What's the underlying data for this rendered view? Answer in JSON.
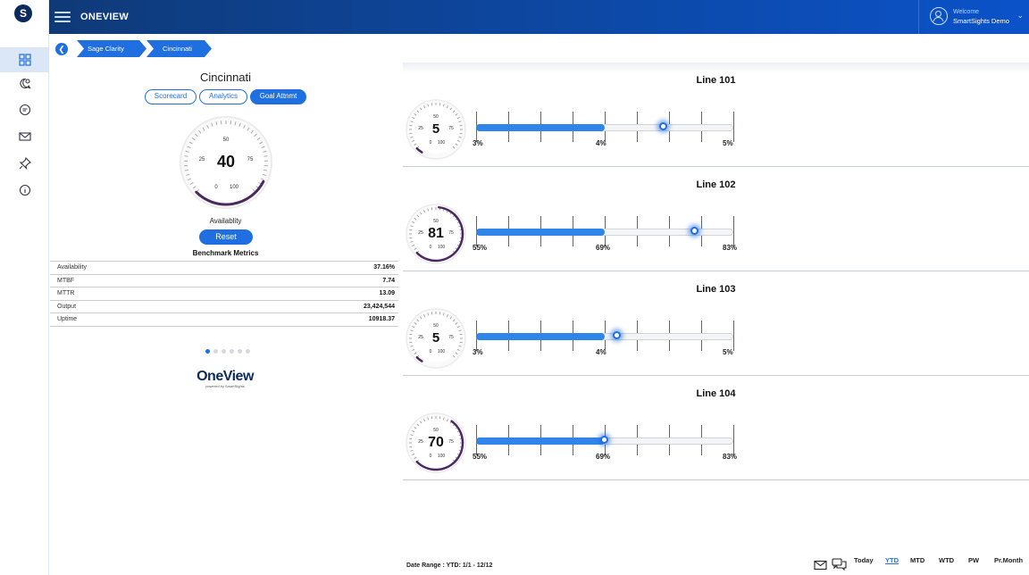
{
  "app": {
    "title": "ONEVIEW",
    "logo_letter": "S"
  },
  "user": {
    "welcome": "Welcome",
    "name": "SmartSights Demo"
  },
  "rail": {
    "items": [
      "dashboard-icon",
      "chat-search-icon",
      "chat-icon",
      "mail-icon",
      "pin-icon",
      "info-icon"
    ],
    "active_index": 0
  },
  "breadcrumb": [
    "Sage Clarity",
    "Cincinnati"
  ],
  "left": {
    "title": "Cincinnati",
    "tabs": [
      {
        "label": "Scorecard",
        "active": false
      },
      {
        "label": "Analytics",
        "active": false
      },
      {
        "label": "Goal Attnmt",
        "active": true
      }
    ],
    "gauge": {
      "value": "40",
      "ticks": [
        "0",
        "25",
        "50",
        "75",
        "100"
      ],
      "level": 0.4
    },
    "gauge_label": "Availablity",
    "reset_label": "Reset",
    "benchmark_title": "Benchmark Metrics",
    "metrics": [
      {
        "name": "Availability",
        "value": "37.16%"
      },
      {
        "name": "MTBF",
        "value": "7.74"
      },
      {
        "name": "MTTR",
        "value": "13.09"
      },
      {
        "name": "Output",
        "value": "23,424,544"
      },
      {
        "name": "Uptime",
        "value": "10918.37"
      }
    ],
    "pager": {
      "count": 6,
      "active": 0
    },
    "brand": {
      "name": "OneView",
      "sub": "powered by SmartSights"
    }
  },
  "lines": [
    {
      "title": "Line 101",
      "gauge_value": "5",
      "gauge_level": 0.05,
      "fill_fraction": 0.5,
      "marker_fraction": 0.73,
      "labels": [
        "3%",
        "4%",
        "5%"
      ]
    },
    {
      "title": "Line 102",
      "gauge_value": "81",
      "gauge_level": 0.81,
      "fill_fraction": 0.5,
      "marker_fraction": 0.85,
      "labels": [
        "55%",
        "69%",
        "83%"
      ]
    },
    {
      "title": "Line 103",
      "gauge_value": "5",
      "gauge_level": 0.05,
      "fill_fraction": 0.5,
      "marker_fraction": 0.55,
      "labels": [
        "3%",
        "4%",
        "5%"
      ]
    },
    {
      "title": "Line 104",
      "gauge_value": "70",
      "gauge_level": 0.7,
      "fill_fraction": 0.5,
      "marker_fraction": 0.5,
      "labels": [
        "55%",
        "69%",
        "83%"
      ]
    }
  ],
  "small_gauge_ticks": [
    "0",
    "25",
    "50",
    "75",
    "100"
  ],
  "footer": {
    "date_range": "Date Range : YTD: 1/1 - 12/12",
    "periods": [
      {
        "label": "Today",
        "active": false
      },
      {
        "label": "YTD",
        "active": true
      },
      {
        "label": "MTD",
        "active": false
      },
      {
        "label": "WTD",
        "active": false
      },
      {
        "label": "PW",
        "active": false
      },
      {
        "label": "Pr.Month",
        "active": false
      }
    ]
  },
  "colors": {
    "accent": "#1f6fe0",
    "header": "#0d47a1",
    "gauge_arc": "#4a2a5e"
  }
}
